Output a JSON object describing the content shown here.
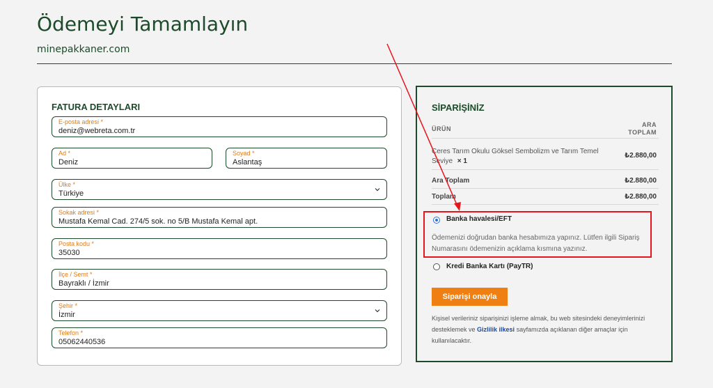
{
  "header": {
    "title": "Ödemeyi Tamamlayın",
    "site": "minepakkaner.com"
  },
  "billing": {
    "title": "FATURA DETAYLARI",
    "fields": {
      "email": {
        "label": "E-posta adresi *",
        "value": "deniz@webreta.com.tr"
      },
      "first_name": {
        "label": "Ad *",
        "value": "Deniz"
      },
      "last_name": {
        "label": "Soyad *",
        "value": "Aslantaş"
      },
      "country": {
        "label": "Ülke *",
        "value": "Türkiye"
      },
      "street": {
        "label": "Sokak adresi *",
        "value": "Mustafa Kemal Cad. 274/5 sok. no 5/B Mustafa Kemal apt."
      },
      "postcode": {
        "label": "Posta kodu *",
        "value": "35030"
      },
      "district": {
        "label": "İlçe / Semt *",
        "value": "Bayraklı / İzmir"
      },
      "city": {
        "label": "Şehir *",
        "value": "İzmir"
      },
      "phone": {
        "label": "Telefon *",
        "value": "05062440536"
      }
    }
  },
  "order": {
    "title": "SİPARİŞİNİZ",
    "col_product": "ÜRÜN",
    "col_subtotal_line1": "ARA",
    "col_subtotal_line2": "TOPLAM",
    "product_name": "Ceres Tarım Okulu Göksel Sembolizm ve Tarım Temel Seviye",
    "product_qty": "× 1",
    "product_amount": "₺2.880,00",
    "subtotal_label": "Ara Toplam",
    "subtotal_amount": "₺2.880,00",
    "total_label": "Toplam",
    "total_amount": "₺2.880,00"
  },
  "payment": {
    "bank_transfer_label": "Banka havalesi/EFT",
    "bank_transfer_desc": "Ödemenizi doğrudan banka hesabımıza yapınız. Lütfen ilgili Sipariş Numarasını ödemenizin açıklama kısmına yazınız.",
    "credit_card_label": "Kredi Banka Kartı (PayTR)",
    "confirm_button": "Siparişi onayla",
    "privacy_before": "Kişisel verileriniz siparişinizi işleme almak, bu web sitesindeki deneyimlerinizi desteklemek ve ",
    "privacy_link": "Gizlilik ilkesi",
    "privacy_after": " sayfamızda açıklanan diğer amaçlar için kullanılacaktır."
  },
  "colors": {
    "brand_green": "#1d4a2a",
    "accent_orange": "#f07f13",
    "label_orange": "#e07b16",
    "annotation_red": "#e8141c"
  }
}
